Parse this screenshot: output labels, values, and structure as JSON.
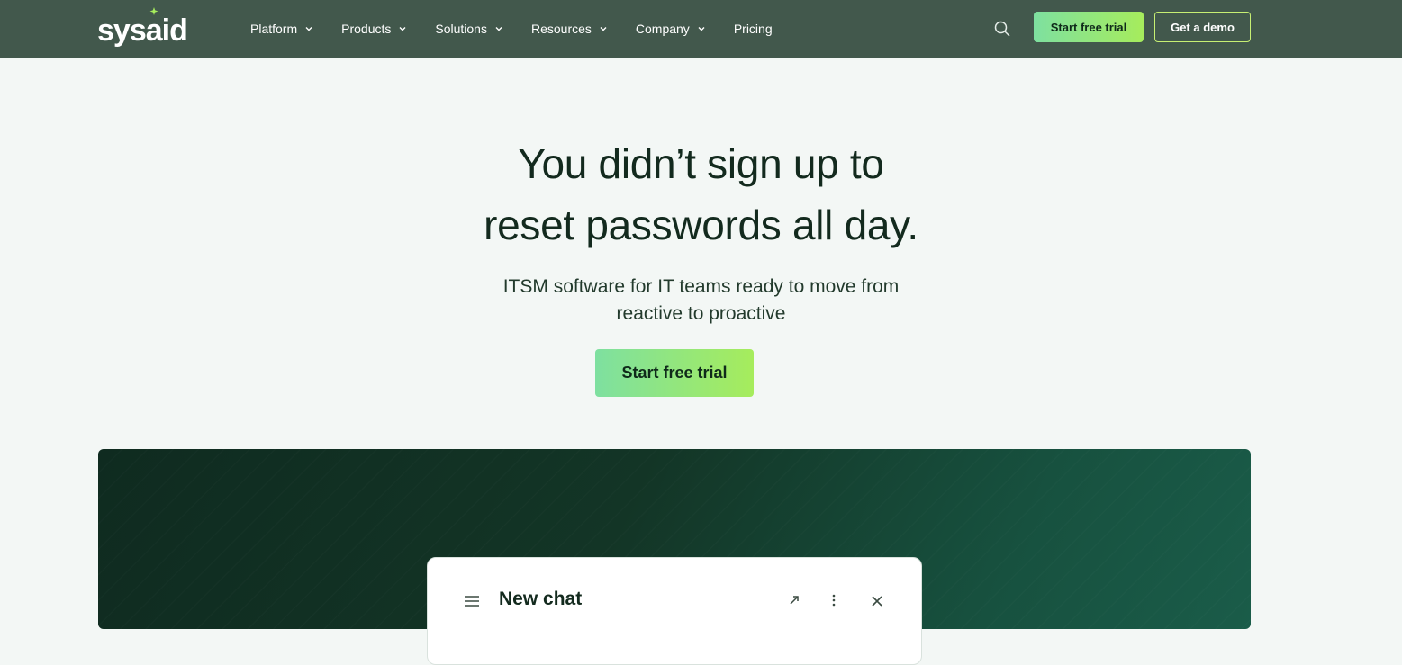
{
  "brand": {
    "logo_text_prefix": "sys",
    "logo_text_a": "a",
    "logo_text_suffix": "id",
    "accent": "#a6ec5c",
    "nav_bg": "#42584c"
  },
  "nav": {
    "items": [
      {
        "label": "Platform",
        "has_dropdown": true
      },
      {
        "label": "Products",
        "has_dropdown": true
      },
      {
        "label": "Solutions",
        "has_dropdown": true
      },
      {
        "label": "Resources",
        "has_dropdown": true
      },
      {
        "label": "Company",
        "has_dropdown": true
      },
      {
        "label": "Pricing",
        "has_dropdown": false
      }
    ],
    "search_icon": "search-icon",
    "trial_label": "Start free trial",
    "demo_label": "Get a demo"
  },
  "hero": {
    "title_line1": "You didn’t sign up to",
    "title_line2": "reset passwords all day.",
    "subtitle_line1": "ITSM software for IT teams ready to move from",
    "subtitle_line2": "reactive to proactive",
    "cta_label": "Start free trial"
  },
  "chat": {
    "title": "New chat",
    "icons": [
      "menu-icon",
      "expand-icon",
      "more-icon",
      "close-icon"
    ]
  }
}
